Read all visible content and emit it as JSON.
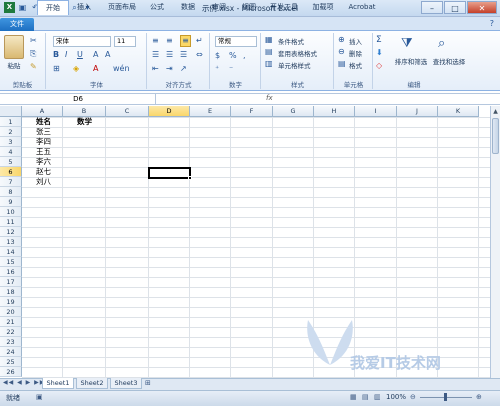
{
  "window": {
    "title": "示例.xlsx - Microsoft Excel"
  },
  "tabs": [
    "文件",
    "开始",
    "插入",
    "页面布局",
    "公式",
    "数据",
    "审阅",
    "视图",
    "开发工具",
    "加载项",
    "Acrobat"
  ],
  "ribbon": {
    "clipboard": {
      "paste": "粘贴",
      "label": "剪贴板"
    },
    "font": {
      "name": "宋体",
      "size": "11",
      "label": "字体"
    },
    "alignment": {
      "label": "对齐方式"
    },
    "number": {
      "format": "常规",
      "label": "数字"
    },
    "styles": {
      "cond": "条件格式",
      "table": "套用表格格式",
      "cell": "单元格样式",
      "label": "样式"
    },
    "cells": {
      "insert": "插入",
      "delete": "删除",
      "format": "格式",
      "label": "单元格"
    },
    "editing": {
      "sort": "排序和筛选",
      "find": "查找和选择",
      "label": "编辑"
    }
  },
  "formula_bar": {
    "namebox": "D6",
    "fx": "fx",
    "value": ""
  },
  "columns": [
    "A",
    "B",
    "C",
    "D",
    "E",
    "F",
    "G",
    "H",
    "I",
    "J",
    "K"
  ],
  "rows": [
    "1",
    "2",
    "3",
    "4",
    "5",
    "6",
    "7",
    "8",
    "9",
    "10",
    "11",
    "12",
    "13",
    "14",
    "15",
    "16",
    "17",
    "18",
    "19",
    "20",
    "21",
    "22",
    "23",
    "24",
    "25",
    "26"
  ],
  "cells": {
    "A1": "姓名",
    "B1": "数学",
    "A2": "张三",
    "A3": "李四",
    "A4": "王五",
    "A5": "李六",
    "A6": "赵七",
    "A7": "刘八"
  },
  "sheets": [
    "Sheet1",
    "Sheet2",
    "Sheet3"
  ],
  "status": {
    "ready": "就绪",
    "zoom": "100%"
  },
  "watermark": "我爱IT技术网"
}
